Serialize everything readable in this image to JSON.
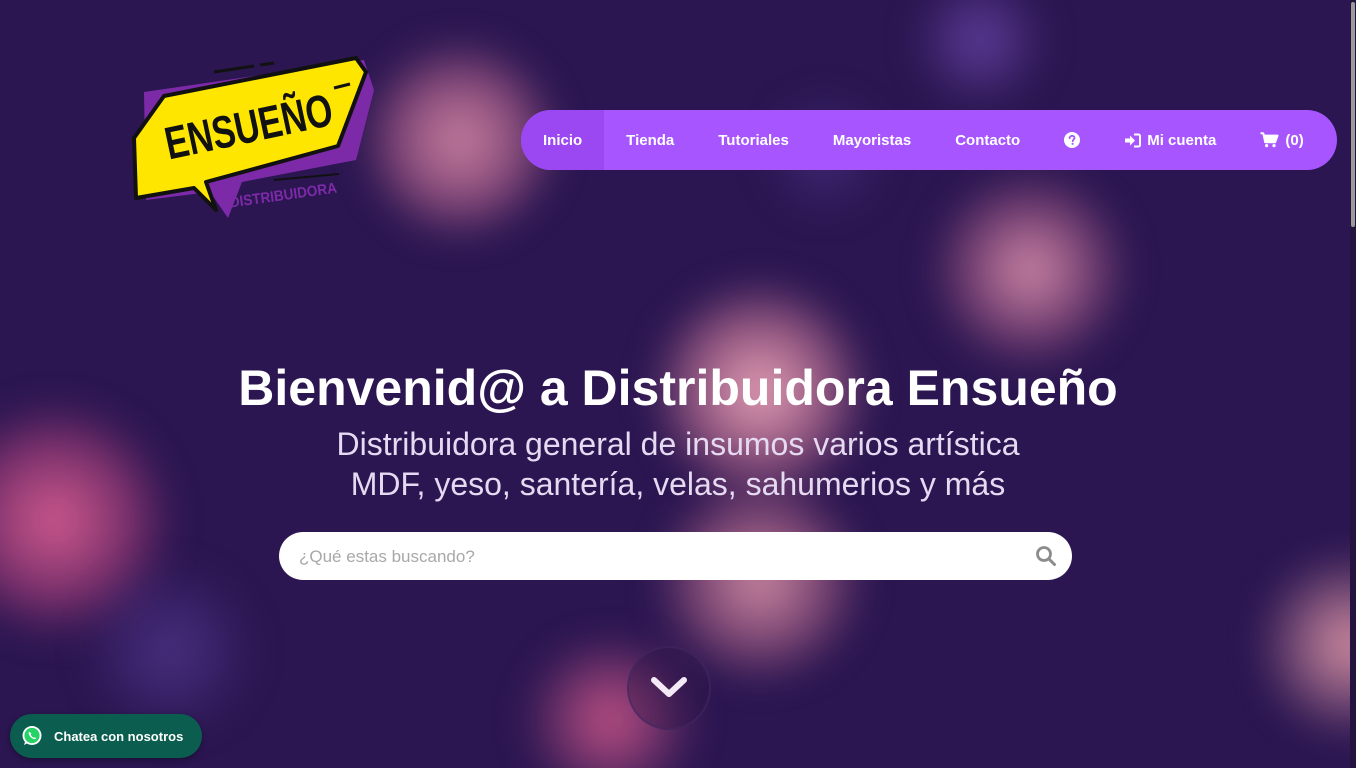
{
  "brand": {
    "logo_text": "ENSUEÑO",
    "logo_subtext": "DISTRIBUIDORA"
  },
  "nav": {
    "items": [
      {
        "label": "Inicio"
      },
      {
        "label": "Tienda"
      },
      {
        "label": "Tutoriales"
      },
      {
        "label": "Mayoristas"
      },
      {
        "label": "Contacto"
      }
    ],
    "help_icon": "question-circle-icon",
    "account_label": "Mi cuenta",
    "account_icon": "sign-in-icon",
    "cart_label": "(0)",
    "cart_icon": "shopping-cart-icon"
  },
  "hero": {
    "title": "Bienvenid@ a Distribuidora Ensueño",
    "subtitle_line1": "Distribuidora general de insumos varios artística",
    "subtitle_line2": "MDF, yeso, santería, velas, sahumerios y más"
  },
  "search": {
    "placeholder": "¿Qué estas buscando?",
    "value": "",
    "icon": "search-icon"
  },
  "scroll_down": {
    "icon": "chevron-down-icon"
  },
  "whatsapp": {
    "label": "Chatea con nosotros",
    "icon": "whatsapp-icon"
  },
  "colors": {
    "background": "#2b1651",
    "nav_bg": "#a655ff",
    "nav_active": "#9b48f2",
    "logo_yellow": "#ffe600",
    "logo_purple": "#7d2aa8",
    "whatsapp_bg": "#0b5e4f"
  }
}
